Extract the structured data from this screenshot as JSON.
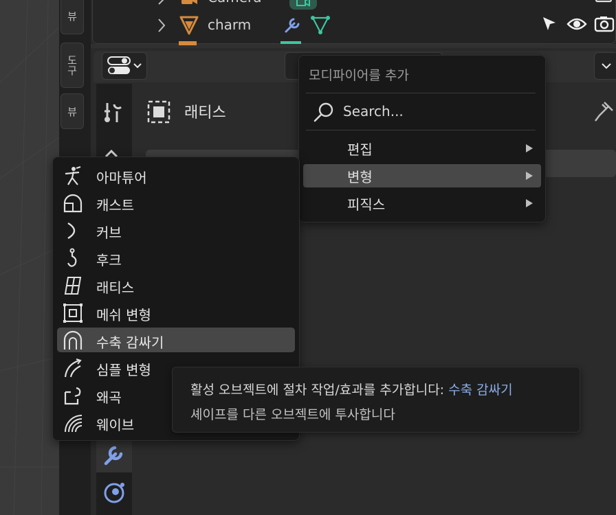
{
  "colors": {
    "accent": "#8aaee8",
    "highlight": "#484848",
    "menu_bg": "#181818",
    "object_orange": "#d68a3c",
    "data_green": "#3cc7a0",
    "tool_blue": "#7fa0ea"
  },
  "sidebar_tabs": [
    "뷰",
    "도구",
    "뷰"
  ],
  "outliner": {
    "rows": [
      {
        "name": "Camera",
        "icon": "camera-object-icon"
      },
      {
        "name": "charm",
        "icon": "mesh-cone-icon"
      }
    ]
  },
  "properties": {
    "modifier_name": "래티스",
    "tabs": [
      "tool-icon",
      "render-icon",
      "wrench-icon",
      "physics-icon"
    ]
  },
  "add_modifier_menu": {
    "title": "모디파이어를 추가",
    "search_placeholder": "Search...",
    "items": [
      {
        "label": "편집",
        "has_submenu": true
      },
      {
        "label": "변형",
        "has_submenu": true,
        "highlighted": true
      },
      {
        "label": "피직스",
        "has_submenu": true
      }
    ]
  },
  "deform_submenu": {
    "items": [
      {
        "label": "아마튜어",
        "icon": "armature-icon"
      },
      {
        "label": "캐스트",
        "icon": "cast-icon"
      },
      {
        "label": "커브",
        "icon": "curve-icon"
      },
      {
        "label": "후크",
        "icon": "hook-icon"
      },
      {
        "label": "래티스",
        "icon": "lattice-icon"
      },
      {
        "label": "메쉬 변형",
        "icon": "mesh-deform-icon"
      },
      {
        "label": "수축 감싸기",
        "icon": "shrinkwrap-icon",
        "highlighted": true
      },
      {
        "label": "심플 변형",
        "icon": "simple-deform-icon"
      },
      {
        "label": "왜곡",
        "icon": "warp-icon"
      },
      {
        "label": "웨이브",
        "icon": "wave-icon"
      }
    ]
  },
  "tooltip": {
    "line1_prefix": "활성 오브젝트에 절차 작업/효과를 추가합니다: ",
    "line1_accent": "수축 감싸기",
    "line2": "셰이프를 다른 오브젝트에 투사합니다"
  }
}
